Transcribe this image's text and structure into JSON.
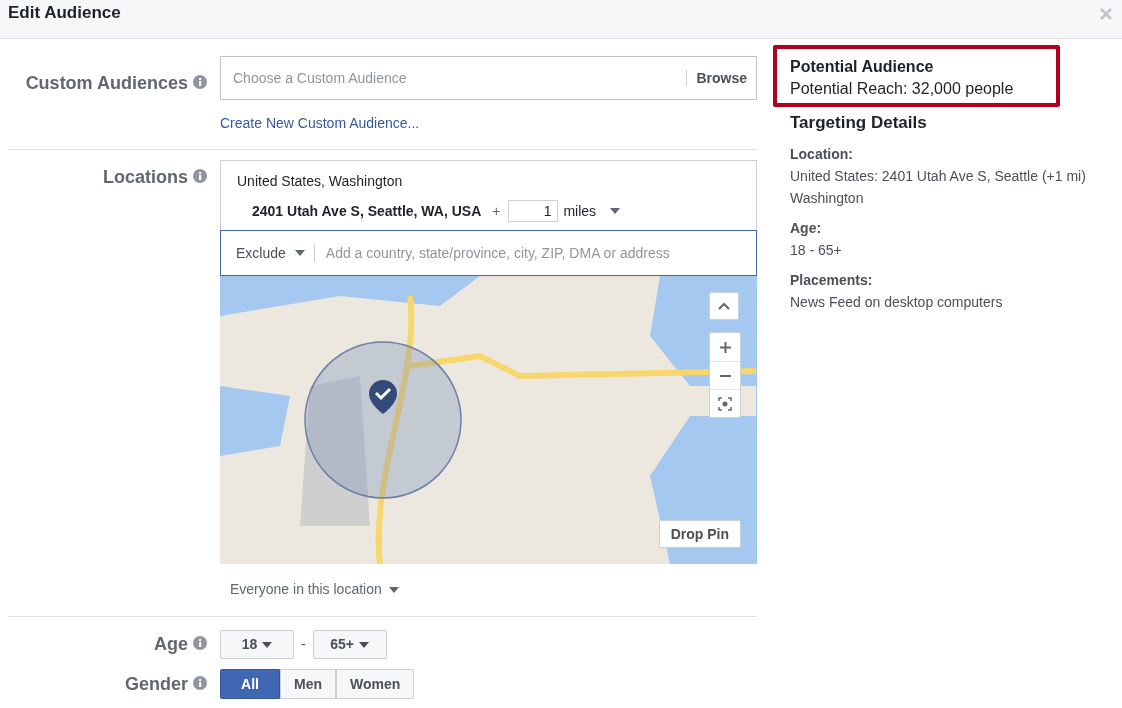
{
  "window": {
    "title": "Edit Audience"
  },
  "custom_audiences": {
    "label": "Custom Audiences",
    "placeholder": "Choose a Custom Audience",
    "browse": "Browse",
    "create_link": "Create New Custom Audience..."
  },
  "locations": {
    "label": "Locations",
    "included": [
      {
        "kind": "region",
        "name": "United States, Washington"
      },
      {
        "kind": "address",
        "name": "2401 Utah Ave S, Seattle, WA, USA",
        "plus": "+",
        "radius": "1",
        "unit": "miles"
      }
    ],
    "exclude_mode": "Exclude",
    "search_placeholder": "Add a country, state/province, city, ZIP, DMA or address",
    "drop_pin": "Drop Pin",
    "audience_type": "Everyone in this location"
  },
  "age": {
    "label": "Age",
    "min": "18",
    "separator": "-",
    "max": "65+"
  },
  "gender": {
    "label": "Gender",
    "options": [
      {
        "label": "All",
        "selected": true
      },
      {
        "label": "Men",
        "selected": false
      },
      {
        "label": "Women",
        "selected": false
      }
    ]
  },
  "potential_audience": {
    "title": "Potential Audience",
    "reach": "Potential Reach: 32,000 people"
  },
  "targeting_details": {
    "title": "Targeting Details",
    "sections": [
      {
        "heading": "Location:",
        "lines": [
          "United States: 2401 Utah Ave S, Seattle (+1 mi)",
          "Washington"
        ]
      },
      {
        "heading": "Age:",
        "lines": [
          "18 - 65+"
        ]
      },
      {
        "heading": "Placements:",
        "lines": [
          "News Feed on desktop computers"
        ]
      }
    ]
  }
}
